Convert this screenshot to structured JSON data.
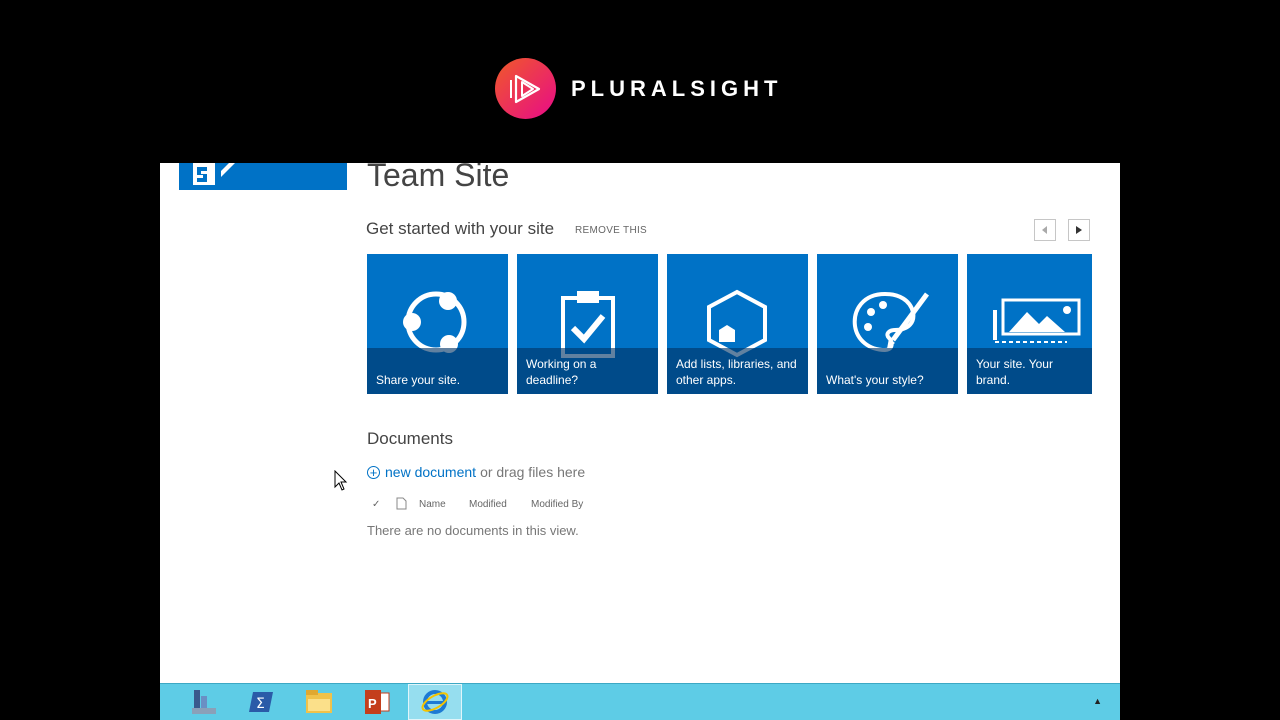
{
  "brand": {
    "name": "PLURALSIGHT"
  },
  "site": {
    "title": "Team Site"
  },
  "get_started": {
    "title": "Get started with your site",
    "remove": "REMOVE THIS",
    "tiles": [
      {
        "icon": "share-icon",
        "caption": "Share your site."
      },
      {
        "icon": "clipboard-check-icon",
        "caption": "Working on a deadline?"
      },
      {
        "icon": "apps-hexagon-icon",
        "caption": "Add lists, libraries, and other apps."
      },
      {
        "icon": "palette-icon",
        "caption": "What's your style?"
      },
      {
        "icon": "image-brand-icon",
        "caption": "Your site. Your brand."
      }
    ]
  },
  "documents": {
    "title": "Documents",
    "new_link": "new document",
    "new_rest": "or drag files here",
    "columns": {
      "check": "✓",
      "name": "Name",
      "modified": "Modified",
      "modified_by": "Modified By"
    },
    "empty": "There are no documents in this view."
  },
  "taskbar": {
    "items": [
      "server-manager-icon",
      "powershell-icon",
      "file-explorer-icon",
      "powerpoint-icon",
      "internet-explorer-icon"
    ],
    "tray": "▲"
  },
  "colors": {
    "tile_blue": "#0072c6",
    "taskbar": "#5ecce6",
    "link": "#0072c6"
  }
}
